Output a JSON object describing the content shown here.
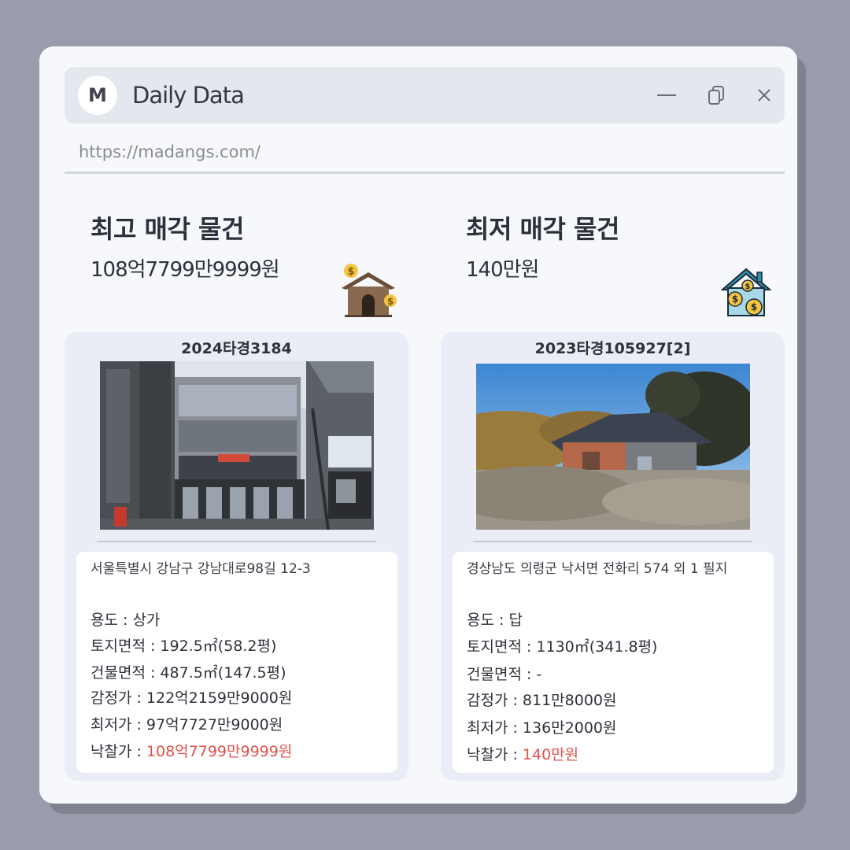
{
  "window": {
    "logo_letter": "M",
    "title": "Daily Data",
    "url": "https://madangs.com/"
  },
  "sections": {
    "highest": {
      "title": "최고 매각 물건",
      "price": "108억7799만9999원",
      "icon": "house-money-icon",
      "case_no": "2024타경3184",
      "address": "서울특별시 강남구 강남대로98길 12-3",
      "usage_label": "용도 : ",
      "usage": "상가",
      "land_label": "토지면적 : ",
      "land_area": "192.5㎡(58.2평)",
      "building_label": "건물면적 : ",
      "building_area": "487.5㎡(147.5평)",
      "appraisal_label": "감정가 : ",
      "appraisal": "122억2159만9000원",
      "minimum_label": "최저가 : ",
      "minimum": "97억7727만9000원",
      "winning_label": "낙찰가 : ",
      "winning": "108억7799만9999원"
    },
    "lowest": {
      "title": "최저 매각 물건",
      "price": "140만원",
      "icon": "house-coins-icon",
      "case_no": "2023타경105927[2]",
      "address": "경상남도 의령군 낙서면 전화리 574 외 1 필지",
      "usage_label": "용도 : ",
      "usage": "답",
      "land_label": "토지면적 : ",
      "land_area": "1130㎡(341.8평)",
      "building_label": "건물면적 : ",
      "building_area": "-",
      "appraisal_label": "감정가 : ",
      "appraisal": "811만8000원",
      "minimum_label": "최저가 : ",
      "minimum": "136만2000원",
      "winning_label": "낙찰가 : ",
      "winning": "140만원"
    }
  },
  "colors": {
    "highlight": "#e2514a",
    "background": "#9a9cae",
    "window": "#f7f8fc",
    "card": "#eaecf6"
  }
}
